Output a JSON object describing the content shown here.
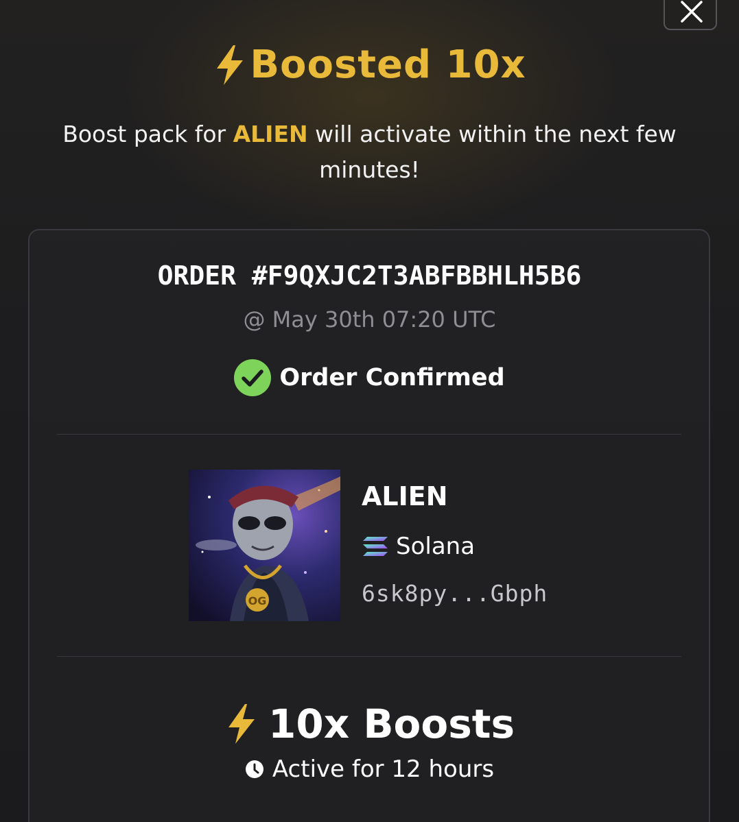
{
  "header": {
    "title": "Boosted 10x",
    "subtitle_prefix": "Boost pack for ",
    "subtitle_token": "ALIEN",
    "subtitle_suffix": " will activate within the next few minutes!"
  },
  "close_button": {
    "icon": "close-icon"
  },
  "order": {
    "id": "ORDER #F9QXJC2T3ABFBBHLH5B6",
    "timestamp": "@ May 30th 07:20 UTC",
    "status": "Order Confirmed",
    "status_icon": "check-circle-icon"
  },
  "token": {
    "name": "ALIEN",
    "chain": "Solana",
    "chain_icon": "solana-icon",
    "address": "6sk8py...Gbph",
    "image_icon": "alien-token-image"
  },
  "boost": {
    "title": "10x Boosts",
    "icon": "lightning-icon",
    "duration": "Active for 12 hours",
    "duration_icon": "clock-icon"
  },
  "colors": {
    "accent": "#e9b93a",
    "success": "#7ed35a",
    "muted": "#8e8e93",
    "background": "#1c1c1e"
  }
}
